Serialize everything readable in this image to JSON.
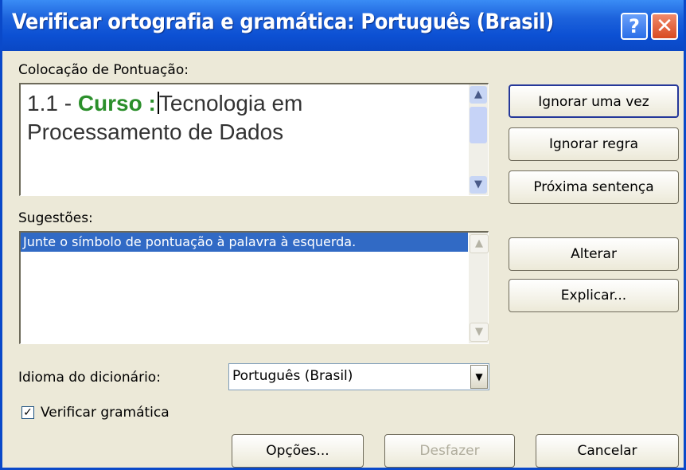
{
  "window": {
    "title": "Verificar ortografia e gramática: Português (Brasil)",
    "help_icon": "?",
    "close_icon": "✕"
  },
  "sentence_panel": {
    "label": "Colocação de Pontuação:",
    "prefix": "1.1 - ",
    "error_text": "Curso :",
    "rest": "Tecnologia em Processamento de Dados"
  },
  "suggestions_panel": {
    "label": "Sugestões:",
    "items": [
      "Junte o símbolo de pontuação à palavra à esquerda."
    ]
  },
  "side_buttons": {
    "ignore_once": "Ignorar uma vez",
    "ignore_rule": "Ignorar regra",
    "next_sentence": "Próxima sentença",
    "change": "Alterar",
    "explain": "Explicar..."
  },
  "dictionary": {
    "label": "Idioma do dicionário:",
    "selected": "Português (Brasil)"
  },
  "grammar_check": {
    "label": "Verificar gramática",
    "checked": true
  },
  "bottom_buttons": {
    "options": "Opções...",
    "undo": "Desfazer",
    "cancel": "Cancelar"
  },
  "colors": {
    "title_blue": "#0a47c4",
    "error_green": "#2b8f2b",
    "selection_blue": "#316ac5",
    "dialog_bg": "#ece9d8"
  }
}
